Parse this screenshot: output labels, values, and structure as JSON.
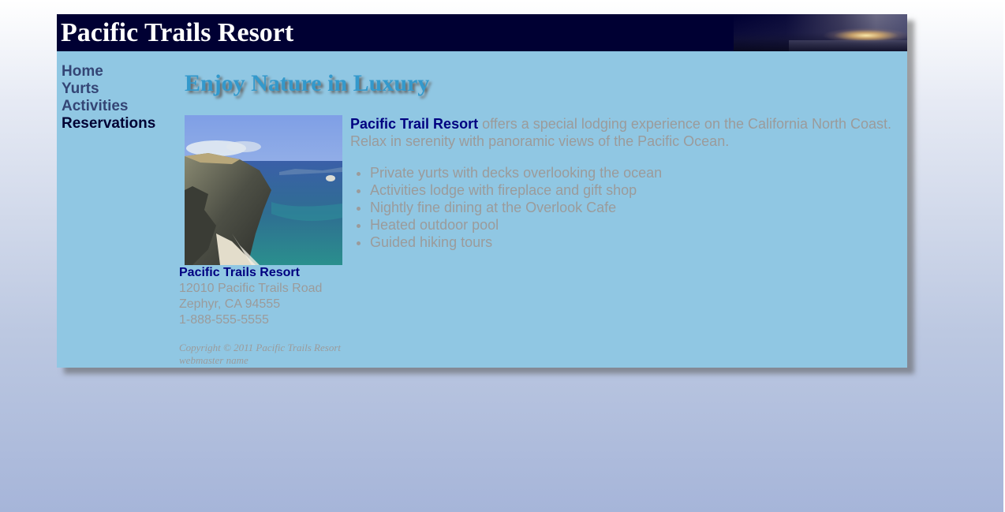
{
  "header": {
    "title": "Pacific Trails Resort"
  },
  "nav": {
    "items": [
      {
        "label": "Home"
      },
      {
        "label": "Yurts"
      },
      {
        "label": "Activities"
      },
      {
        "label": "Reservations"
      }
    ]
  },
  "main": {
    "heading": "Enjoy Nature in Luxury",
    "intro_brand": "Pacific Trail Resort",
    "intro_text": " offers a special lodging experience on the California North Coast. Relax in serenity with panoramic views of the Pacific Ocean.",
    "features": [
      "Private yurts with decks overlooking the ocean",
      "Activities lodge with fireplace and gift shop",
      "Nightly fine dining at the Overlook Cafe",
      "Heated outdoor pool",
      "Guided hiking tours"
    ],
    "photo_icon": "coastline-photo"
  },
  "contact": {
    "name": "Pacific Trails Resort",
    "street": "12010 Pacific Trails Road",
    "city": "Zephyr, CA 94555",
    "phone": "1-888-555-5555"
  },
  "footer": {
    "copyright": "Copyright © 2011 Pacific Trails Resort",
    "webmaster": "webmaster name"
  },
  "colors": {
    "page_background": "#a6b5d9",
    "wrapper_background": "#90c7e3",
    "header_background": "#000033",
    "heading_color": "#3399cc",
    "brand_color": "#000080",
    "body_text": "#9b9b9b",
    "nav_link": "#334478",
    "nav_current": "#000033"
  }
}
